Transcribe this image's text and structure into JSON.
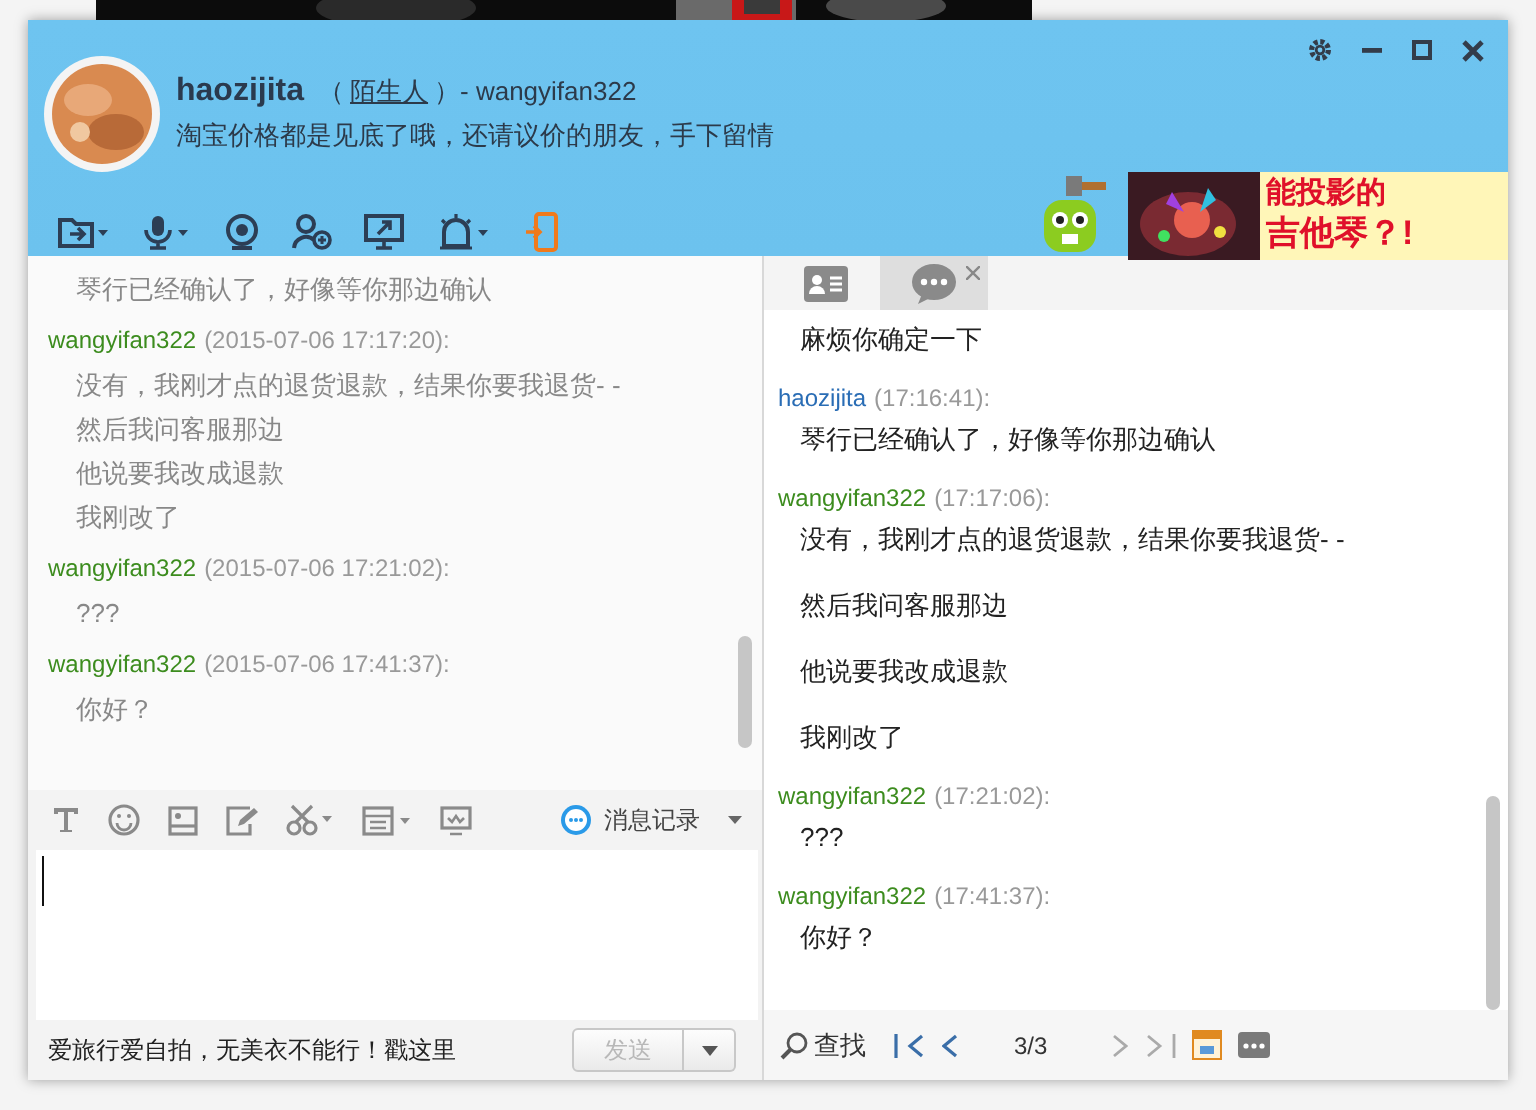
{
  "contact": {
    "name": "haozijita",
    "relation_prefix": "（",
    "relation": "陌生人",
    "relation_suffix": "）- wangyifan322",
    "signature": "淘宝价格都是见底了哦，还请议价的朋友，手下留情"
  },
  "ad": {
    "line1": "能投影的",
    "line2": "吉他琴？!"
  },
  "chat_history": [
    {
      "lines": [
        "琴行已经确认了，好像等你那边确认"
      ]
    },
    {
      "sender": "wangyifan322",
      "color": "#3c8c1e",
      "time": "(2015-07-06 17:17:20):",
      "lines": [
        "没有，我刚才点的退货退款，结果你要我退货- -",
        "然后我问客服那边",
        "他说要我改成退款",
        "我刚改了"
      ]
    },
    {
      "sender": "wangyifan322",
      "color": "#3c8c1e",
      "time": "(2015-07-06 17:21:02):",
      "lines": [
        "???"
      ]
    },
    {
      "sender": "wangyifan322",
      "color": "#3c8c1e",
      "time": "(2015-07-06 17:41:37):",
      "lines": [
        "你好？"
      ]
    }
  ],
  "history_link": "消息记录",
  "input_hint": "爱旅行爱自拍，无美衣不能行！戳这里",
  "send": {
    "label": "发送",
    "disabled": true
  },
  "side_tabs": [
    {
      "kind": "profile",
      "selected": false,
      "closable": false
    },
    {
      "kind": "chat",
      "selected": true,
      "closable": true
    }
  ],
  "record_history": [
    {
      "lines": [
        "麻烦你确定一下"
      ]
    },
    {
      "sender": "haozijita",
      "color": "#2a6db5",
      "time": "(17:16:41):",
      "lines": [
        "琴行已经确认了，好像等你那边确认"
      ]
    },
    {
      "sender": "wangyifan322",
      "color": "#3c8c1e",
      "time": "(17:17:06):",
      "lines": [
        "没有，我刚才点的退货退款，结果你要我退货- -",
        "然后我问客服那边",
        "他说要我改成退款",
        "我刚改了"
      ]
    },
    {
      "sender": "wangyifan322",
      "color": "#3c8c1e",
      "time": "(17:21:02):",
      "lines": [
        "???"
      ]
    },
    {
      "sender": "wangyifan322",
      "color": "#3c8c1e",
      "time": "(17:41:37):",
      "lines": [
        "你好？"
      ]
    }
  ],
  "record_bar": {
    "search": "查找",
    "page": "3/3"
  }
}
